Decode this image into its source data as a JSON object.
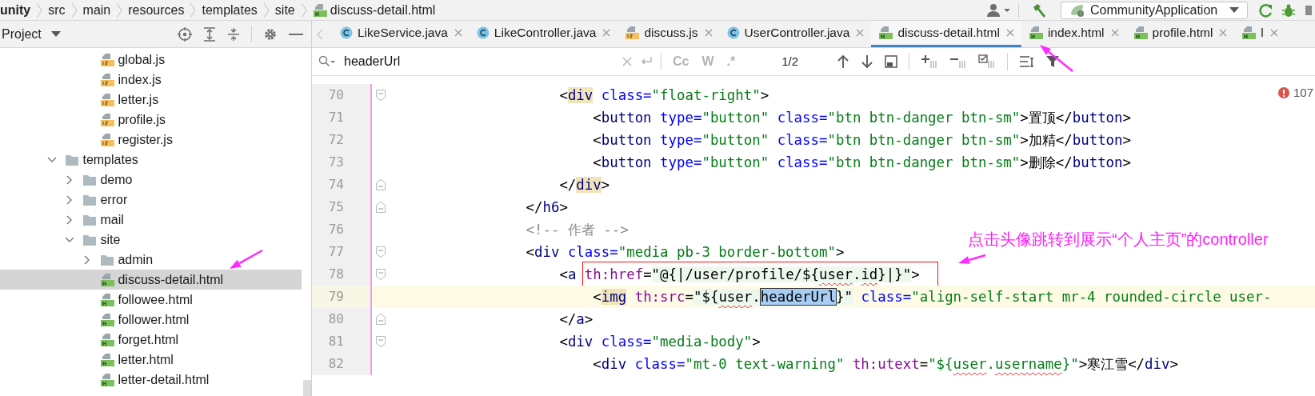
{
  "breadcrumb": [
    {
      "label": "unity",
      "kind": "module"
    },
    {
      "label": "src",
      "kind": "folder"
    },
    {
      "label": "main",
      "kind": "folder"
    },
    {
      "label": "resources",
      "kind": "folder"
    },
    {
      "label": "templates",
      "kind": "folder"
    },
    {
      "label": "site",
      "kind": "folder"
    },
    {
      "label": "discuss-detail.html",
      "kind": "html"
    }
  ],
  "toolbar": {
    "run_config": "CommunityApplication"
  },
  "project_panel": {
    "title": "Project",
    "tree": {
      "continued_items": [
        {
          "label": "global.js",
          "kind": "js",
          "selected": false
        },
        {
          "label": "index.js",
          "kind": "js",
          "selected": false
        },
        {
          "label": "letter.js",
          "kind": "js",
          "selected": false
        },
        {
          "label": "profile.js",
          "kind": "js",
          "selected": false
        },
        {
          "label": "register.js",
          "kind": "js",
          "selected": false
        }
      ],
      "items": [
        {
          "label": "templates",
          "kind": "folder",
          "expanded": true,
          "selected": false,
          "children": [
            {
              "label": "demo",
              "kind": "folder",
              "expanded": false,
              "selected": false
            },
            {
              "label": "error",
              "kind": "folder",
              "expanded": false,
              "selected": false
            },
            {
              "label": "mail",
              "kind": "folder",
              "expanded": false,
              "selected": false
            },
            {
              "label": "site",
              "kind": "folder",
              "expanded": true,
              "selected": false,
              "children": [
                {
                  "label": "admin",
                  "kind": "folder",
                  "expanded": false,
                  "selected": false
                },
                {
                  "label": "discuss-detail.html",
                  "kind": "html",
                  "selected": true
                },
                {
                  "label": "followee.html",
                  "kind": "html",
                  "selected": false
                },
                {
                  "label": "follower.html",
                  "kind": "html",
                  "selected": false
                },
                {
                  "label": "forget.html",
                  "kind": "html",
                  "selected": false
                },
                {
                  "label": "letter.html",
                  "kind": "html",
                  "selected": false
                },
                {
                  "label": "letter-detail.html",
                  "kind": "html",
                  "selected": false
                }
              ]
            }
          ]
        }
      ]
    }
  },
  "tabs": [
    {
      "label": "LikeService.java",
      "kind": "class",
      "selected": false
    },
    {
      "label": "LikeController.java",
      "kind": "class",
      "selected": false
    },
    {
      "label": "discuss.js",
      "kind": "js",
      "selected": false
    },
    {
      "label": "UserController.java",
      "kind": "class",
      "selected": false
    },
    {
      "label": "discuss-detail.html",
      "kind": "html",
      "selected": true
    },
    {
      "label": "index.html",
      "kind": "html",
      "selected": false
    },
    {
      "label": "profile.html",
      "kind": "html",
      "selected": false
    },
    {
      "label": "l",
      "kind": "html",
      "selected": false
    }
  ],
  "find_bar": {
    "query": "headerUrl",
    "options": [
      {
        "label": "Cc",
        "on": false
      },
      {
        "label": "W",
        "on": false
      },
      {
        "label": ".*",
        "on": false
      }
    ],
    "match_count": "1/2"
  },
  "editor": {
    "problems": "107",
    "lines": [
      {
        "number": "70",
        "kind": "fold-start",
        "current": false,
        "tokens": [
          {
            "text": "                    <",
            "kind": "punct"
          },
          {
            "text": "div",
            "kind": "tag",
            "paired": true
          },
          {
            "text": " class=",
            "kind": "attr"
          },
          {
            "text": "\"float-right\"",
            "kind": "value"
          },
          {
            "text": ">",
            "kind": "punct"
          }
        ]
      },
      {
        "number": "71",
        "kind": "plain",
        "current": false,
        "tokens": [
          {
            "text": "                        <",
            "kind": "punct"
          },
          {
            "text": "button",
            "kind": "tag"
          },
          {
            "text": " type=",
            "kind": "attr"
          },
          {
            "text": "\"button\"",
            "kind": "value"
          },
          {
            "text": " class=",
            "kind": "attr"
          },
          {
            "text": "\"btn btn-danger btn-sm\"",
            "kind": "value"
          },
          {
            "text": ">",
            "kind": "punct"
          },
          {
            "text": "置顶",
            "kind": "text"
          },
          {
            "text": "</",
            "kind": "punct"
          },
          {
            "text": "button",
            "kind": "tag"
          },
          {
            "text": ">",
            "kind": "punct"
          }
        ]
      },
      {
        "number": "72",
        "kind": "plain",
        "current": false,
        "tokens": [
          {
            "text": "                        <",
            "kind": "punct"
          },
          {
            "text": "button",
            "kind": "tag"
          },
          {
            "text": " type=",
            "kind": "attr"
          },
          {
            "text": "\"button\"",
            "kind": "value"
          },
          {
            "text": " class=",
            "kind": "attr"
          },
          {
            "text": "\"btn btn-danger btn-sm\"",
            "kind": "value"
          },
          {
            "text": ">",
            "kind": "punct"
          },
          {
            "text": "加精",
            "kind": "text"
          },
          {
            "text": "</",
            "kind": "punct"
          },
          {
            "text": "button",
            "kind": "tag"
          },
          {
            "text": ">",
            "kind": "punct"
          }
        ]
      },
      {
        "number": "73",
        "kind": "plain",
        "current": false,
        "tokens": [
          {
            "text": "                        <",
            "kind": "punct"
          },
          {
            "text": "button",
            "kind": "tag"
          },
          {
            "text": " type=",
            "kind": "attr"
          },
          {
            "text": "\"button\"",
            "kind": "value"
          },
          {
            "text": " class=",
            "kind": "attr"
          },
          {
            "text": "\"btn btn-danger btn-sm\"",
            "kind": "value"
          },
          {
            "text": ">",
            "kind": "punct"
          },
          {
            "text": "删除",
            "kind": "text"
          },
          {
            "text": "</",
            "kind": "punct"
          },
          {
            "text": "button",
            "kind": "tag"
          },
          {
            "text": ">",
            "kind": "punct"
          }
        ]
      },
      {
        "number": "74",
        "kind": "fold-end",
        "current": false,
        "tokens": [
          {
            "text": "                    </",
            "kind": "punct"
          },
          {
            "text": "div",
            "kind": "tag",
            "paired": true
          },
          {
            "text": ">",
            "kind": "punct"
          }
        ]
      },
      {
        "number": "75",
        "kind": "fold-end",
        "current": false,
        "tokens": [
          {
            "text": "                </",
            "kind": "punct"
          },
          {
            "text": "h6",
            "kind": "tag"
          },
          {
            "text": ">",
            "kind": "punct"
          }
        ]
      },
      {
        "number": "76",
        "kind": "plain",
        "current": false,
        "tokens": [
          {
            "text": "                <!-- 作者 -->",
            "kind": "comment"
          }
        ]
      },
      {
        "number": "77",
        "kind": "fold-start",
        "current": false,
        "tokens": [
          {
            "text": "                <",
            "kind": "punct"
          },
          {
            "text": "div",
            "kind": "tag"
          },
          {
            "text": " class=",
            "kind": "attr"
          },
          {
            "text": "\"media pb-3 border-bottom\"",
            "kind": "value"
          },
          {
            "text": ">",
            "kind": "punct"
          }
        ]
      },
      {
        "number": "78",
        "kind": "fold-start",
        "current": false,
        "tokens": [
          {
            "text": "                    <",
            "kind": "punct"
          },
          {
            "text": "a ",
            "kind": "tag"
          }
        ],
        "framed_tokens": [
          {
            "text": "th:href",
            "kind": "ns"
          },
          {
            "text": "=",
            "kind": "punct"
          },
          {
            "text": "\"@{|/user/profile/${",
            "kind": "expr"
          },
          {
            "text": "user",
            "kind": "expr",
            "misspelled": true
          },
          {
            "text": ".",
            "kind": "expr"
          },
          {
            "text": "id",
            "kind": "expr",
            "misspelled": true
          },
          {
            "text": "}|}\"",
            "kind": "expr"
          },
          {
            "text": ">",
            "kind": "punct"
          }
        ]
      },
      {
        "number": "79",
        "kind": "plain",
        "current": true,
        "tokens": [
          {
            "text": "                        <",
            "kind": "punct"
          },
          {
            "text": "img",
            "kind": "tag",
            "paired": true
          },
          {
            "text": " th:src",
            "kind": "ns"
          },
          {
            "text": "=",
            "kind": "punct"
          },
          {
            "text": "\"${",
            "kind": "expr"
          },
          {
            "text": "user",
            "kind": "expr",
            "misspelled": true
          },
          {
            "text": ".",
            "kind": "expr"
          },
          {
            "text": "headerUrl",
            "kind": "match"
          },
          {
            "text": "}\"",
            "kind": "expr"
          },
          {
            "text": " class=",
            "kind": "attr"
          },
          {
            "text": "\"align-self-start mr-4 rounded-circle user-",
            "kind": "value"
          }
        ]
      },
      {
        "number": "80",
        "kind": "fold-end",
        "current": false,
        "tokens": [
          {
            "text": "                    </",
            "kind": "punct"
          },
          {
            "text": "a",
            "kind": "tag"
          },
          {
            "text": ">",
            "kind": "punct"
          }
        ]
      },
      {
        "number": "81",
        "kind": "fold-start",
        "current": false,
        "tokens": [
          {
            "text": "                    <",
            "kind": "punct"
          },
          {
            "text": "div",
            "kind": "tag"
          },
          {
            "text": " class=",
            "kind": "attr"
          },
          {
            "text": "\"media-body\"",
            "kind": "value"
          },
          {
            "text": ">",
            "kind": "punct"
          }
        ]
      },
      {
        "number": "82",
        "kind": "plain",
        "current": false,
        "tokens": [
          {
            "text": "                        <",
            "kind": "punct"
          },
          {
            "text": "div",
            "kind": "tag"
          },
          {
            "text": " class=",
            "kind": "attr"
          },
          {
            "text": "\"mt-0 text-warning\"",
            "kind": "value"
          },
          {
            "text": " th:utext",
            "kind": "ns"
          },
          {
            "text": "=",
            "kind": "punct"
          },
          {
            "text": "\"${",
            "kind": "value"
          },
          {
            "text": "user",
            "kind": "value",
            "misspelled": true
          },
          {
            "text": ".",
            "kind": "value"
          },
          {
            "text": "username",
            "kind": "value",
            "misspelled": true
          },
          {
            "text": "}\"",
            "kind": "value"
          },
          {
            "text": ">",
            "kind": "punct"
          },
          {
            "text": "寒江雪",
            "kind": "text"
          },
          {
            "text": "</",
            "kind": "punct"
          },
          {
            "text": "div",
            "kind": "tag"
          },
          {
            "text": ">",
            "kind": "punct"
          }
        ]
      }
    ]
  },
  "annotation": {
    "note": "点击头像跳转到展示“个人主页”的controller"
  }
}
